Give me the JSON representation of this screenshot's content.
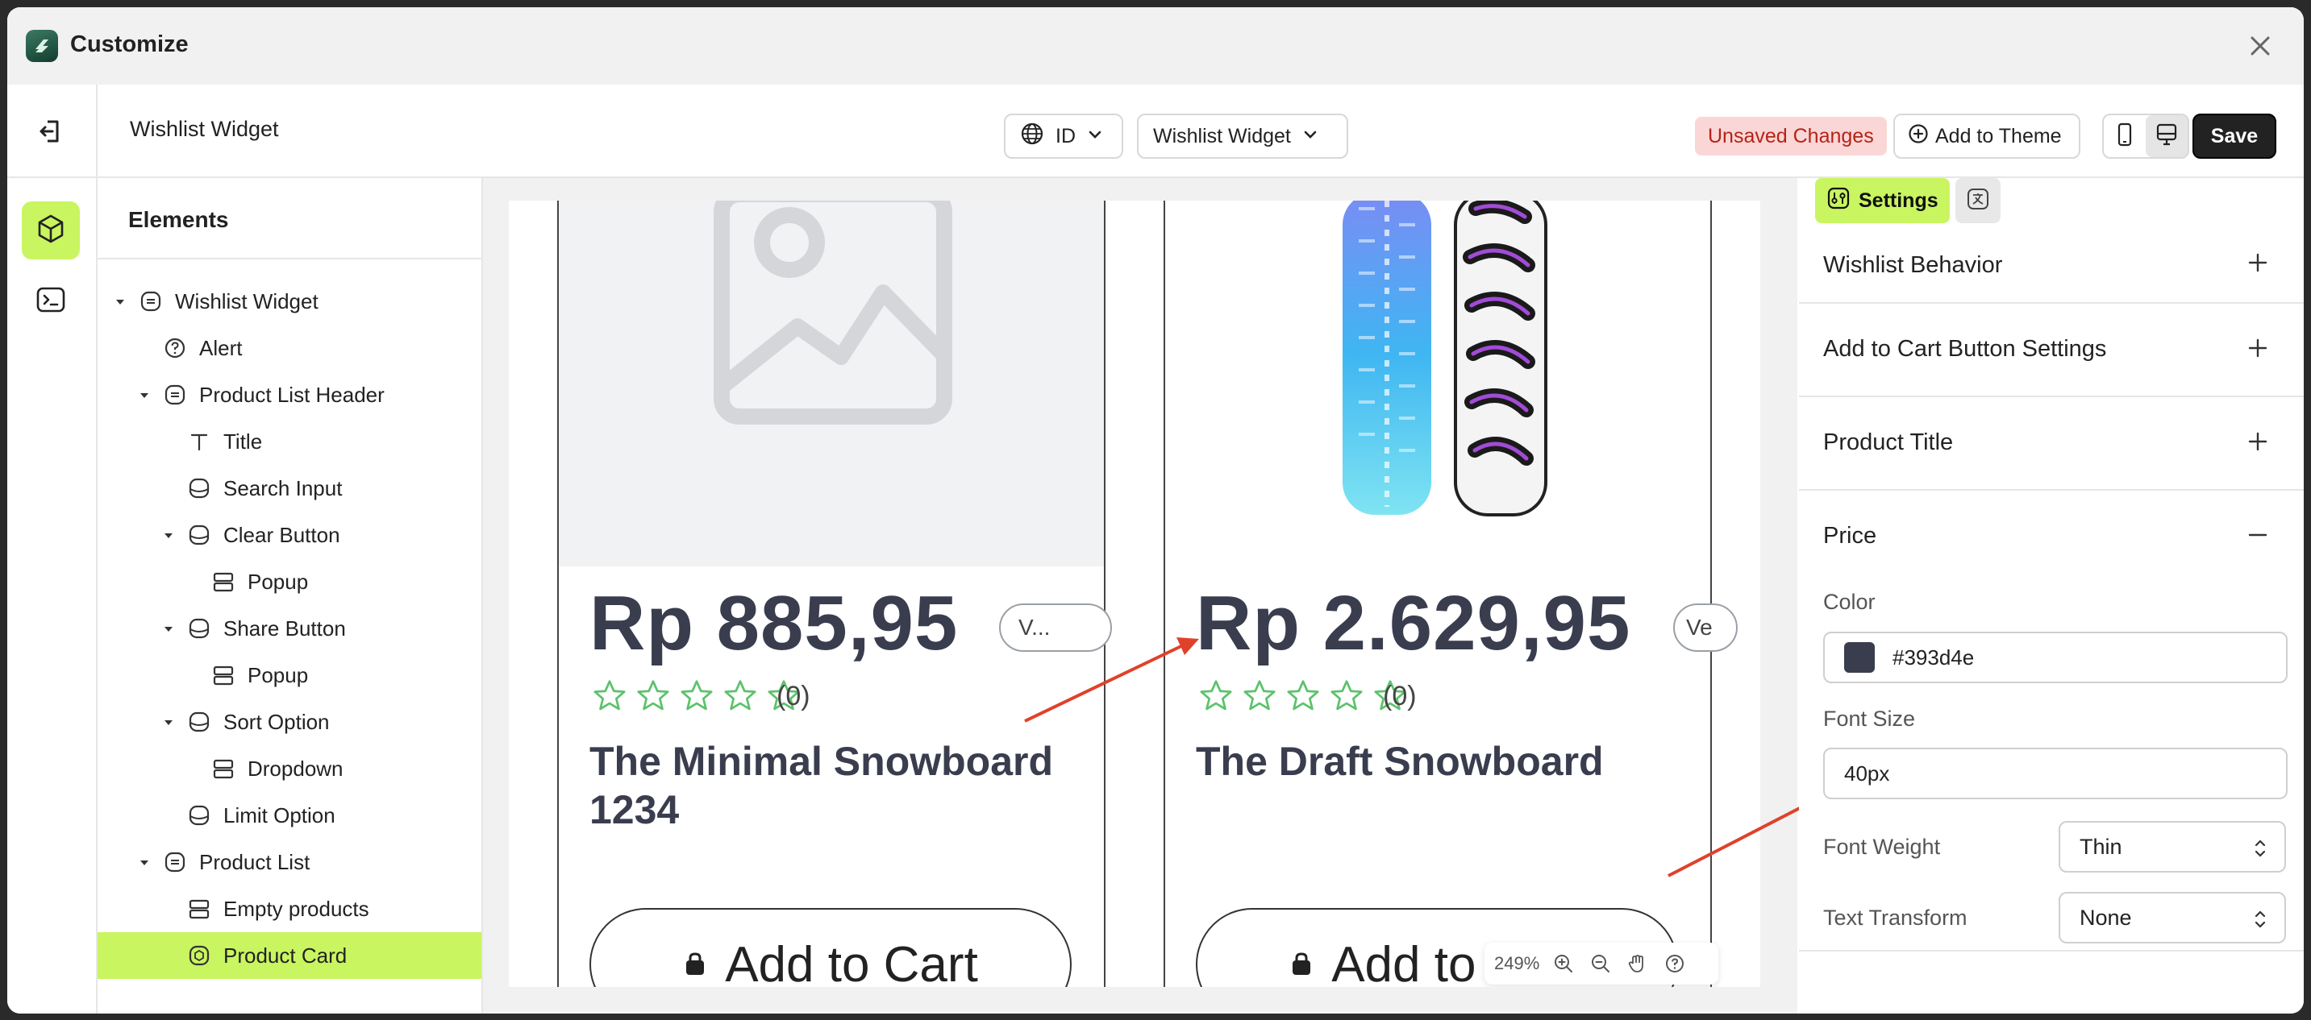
{
  "app": {
    "title": "Customize"
  },
  "header": {
    "title": "Wishlist Widget",
    "language": "ID",
    "template": "Wishlist Widget",
    "unsaved": "Unsaved Changes",
    "add_to_theme": "Add to Theme",
    "save": "Save"
  },
  "elements": {
    "title": "Elements",
    "items": [
      {
        "label": "Wishlist Widget"
      },
      {
        "label": "Alert"
      },
      {
        "label": "Product List Header"
      },
      {
        "label": "Title"
      },
      {
        "label": "Search Input"
      },
      {
        "label": "Clear Button"
      },
      {
        "label": "Popup"
      },
      {
        "label": "Share Button"
      },
      {
        "label": "Popup"
      },
      {
        "label": "Sort Option"
      },
      {
        "label": "Dropdown"
      },
      {
        "label": "Limit Option"
      },
      {
        "label": "Product List"
      },
      {
        "label": "Empty products"
      },
      {
        "label": "Product Card"
      }
    ]
  },
  "preview": {
    "cards": [
      {
        "price": "Rp 885,95",
        "variant": "V...",
        "reviews": "(0)",
        "title_line1": "The Minimal Snowboard",
        "title_line2": "1234",
        "cart": "Add to Cart"
      },
      {
        "price": "Rp 2.629,95",
        "variant": "Ve",
        "reviews": "(0)",
        "title_line1": "The Draft Snowboard",
        "title_line2": "",
        "cart": "Add to Cart"
      }
    ],
    "zoom": "249%"
  },
  "settings": {
    "tab_label": "Settings",
    "sections": {
      "wishlist_behavior": "Wishlist Behavior",
      "add_to_cart": "Add to Cart Button Settings",
      "product_title": "Product Title",
      "price": "Price"
    },
    "price": {
      "color_label": "Color",
      "color_value": "#393d4e",
      "font_size_label": "Font Size",
      "font_size_value": "40px",
      "font_weight_label": "Font Weight",
      "font_weight_value": "Thin",
      "text_transform_label": "Text Transform",
      "text_transform_value": "None"
    }
  },
  "colors": {
    "accent": "#c9f560",
    "price_text": "#393d4e",
    "star": "#5cc26b",
    "arrow": "#e0412b"
  },
  "icons": [
    "app-logo-icon",
    "close-icon",
    "exit-icon",
    "cube-icon",
    "terminal-icon",
    "globe-icon",
    "chevron-down-icon",
    "plus-circle-icon",
    "mobile-icon",
    "desktop-icon",
    "image-placeholder-icon",
    "star-icon",
    "bag-icon",
    "zoom-in-icon",
    "zoom-out-icon",
    "hand-icon",
    "help-icon",
    "settings-icon",
    "translate-icon",
    "plus-icon",
    "minus-icon"
  ]
}
